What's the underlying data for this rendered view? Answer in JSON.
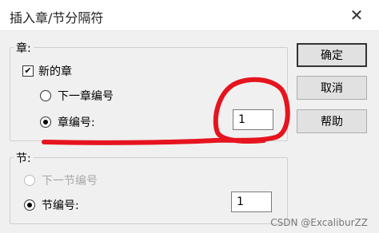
{
  "window": {
    "title": "插入章/节分隔符",
    "close_icon": "close-icon"
  },
  "chapter_group": {
    "legend": "章:",
    "new_chapter_checkbox": {
      "label": "新的章",
      "checked": true
    },
    "next_chapter_radio": {
      "label": "下一章编号",
      "selected": false
    },
    "chapter_number_radio": {
      "label": "章编号:",
      "selected": true
    },
    "chapter_number_value": "1"
  },
  "section_group": {
    "legend": "节:",
    "next_section_radio": {
      "label": "下一节编号",
      "selected": false,
      "disabled": true
    },
    "section_number_radio": {
      "label": "节编号:",
      "selected": true
    },
    "section_number_value": "1"
  },
  "buttons": {
    "ok": "确定",
    "cancel": "取消",
    "help": "帮助"
  },
  "watermark": "CSDN @ExcaliburZZ",
  "colors": {
    "annotation": "#e5141e"
  }
}
